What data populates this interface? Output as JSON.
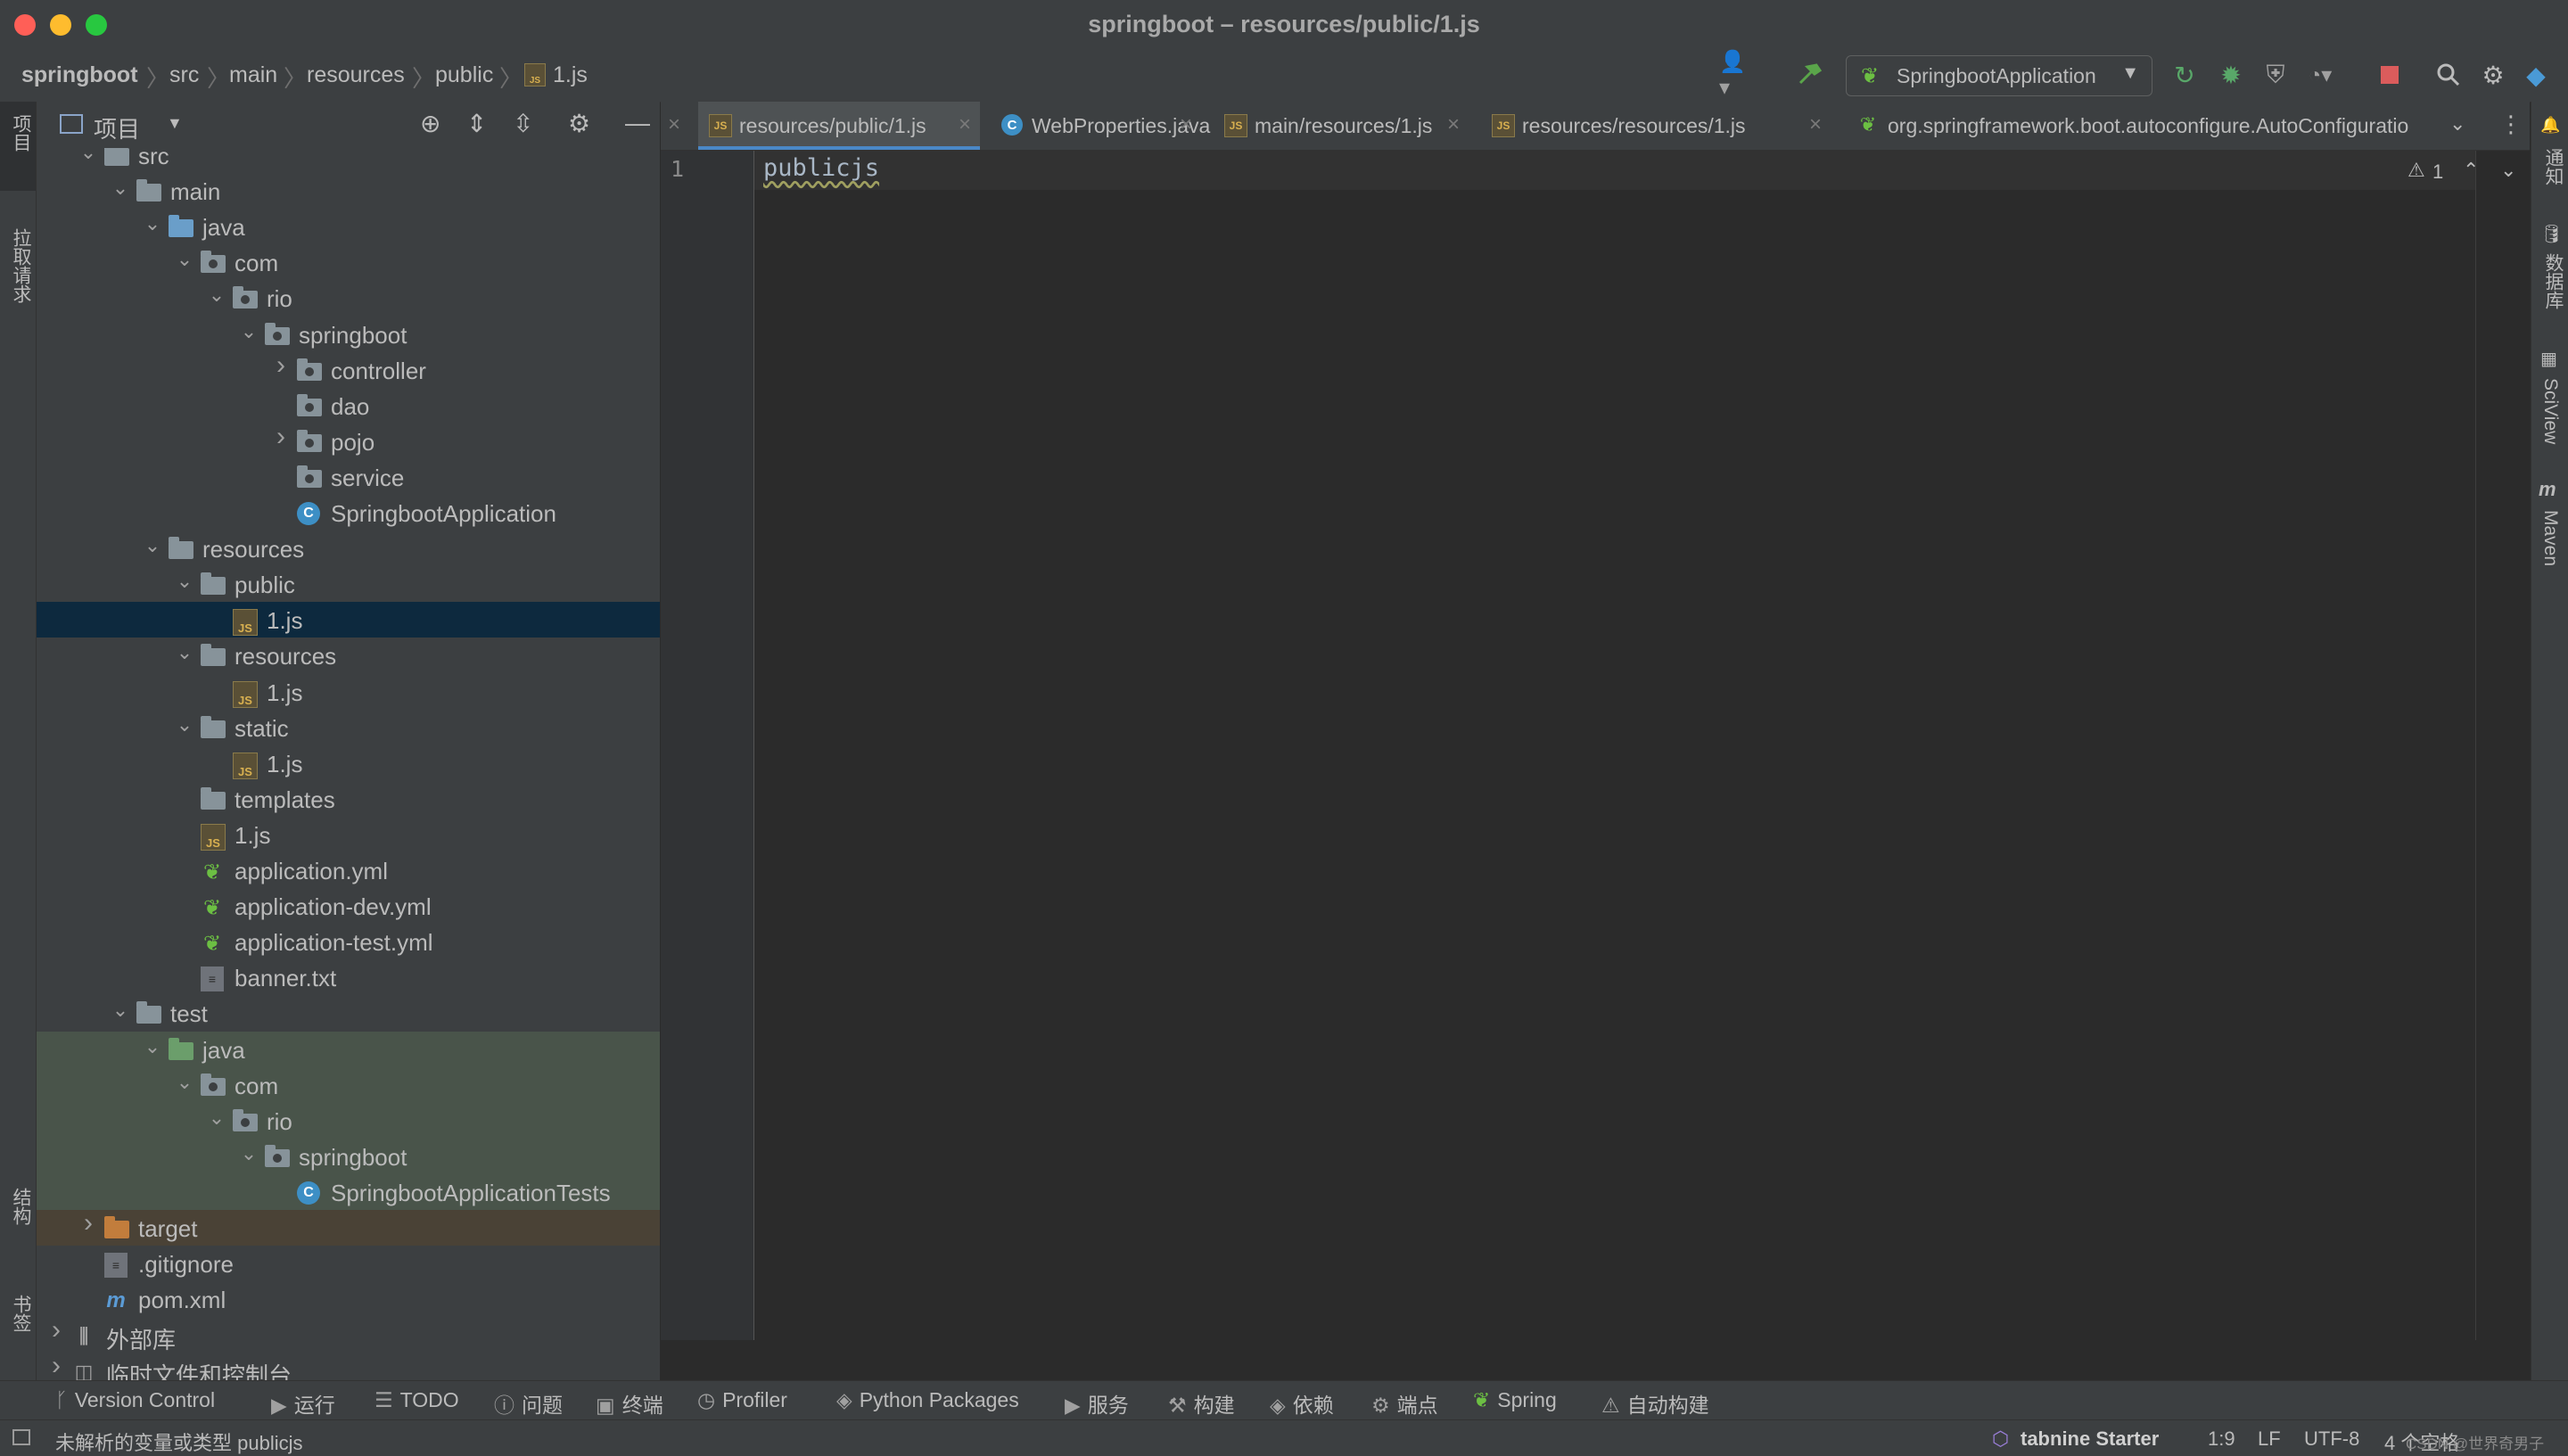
{
  "window": {
    "title": "springboot – resources/public/1.js"
  },
  "breadcrumbs": [
    "springboot",
    "src",
    "main",
    "resources",
    "public",
    "1.js"
  ],
  "run_config": {
    "label": "SpringbootApplication"
  },
  "project_panel": {
    "title": "项目"
  },
  "left_strip": {
    "project": "项目",
    "pull_requests": "拉取请求",
    "structure": "结构",
    "bookmarks": "书签"
  },
  "right_strip": {
    "notifications": "通知",
    "database": "数据库",
    "sciview": "SciView",
    "maven": "Maven"
  },
  "tree": [
    {
      "label": "src",
      "depth": 1,
      "chevron": "open",
      "icon": "folder"
    },
    {
      "label": "main",
      "depth": 2,
      "chevron": "open",
      "icon": "folder"
    },
    {
      "label": "java",
      "depth": 3,
      "chevron": "open",
      "icon": "folder-blue"
    },
    {
      "label": "com",
      "depth": 4,
      "chevron": "open",
      "icon": "package"
    },
    {
      "label": "rio",
      "depth": 5,
      "chevron": "open",
      "icon": "package"
    },
    {
      "label": "springboot",
      "depth": 6,
      "chevron": "open",
      "icon": "package"
    },
    {
      "label": "controller",
      "depth": 7,
      "chevron": "closed",
      "icon": "package"
    },
    {
      "label": "dao",
      "depth": 7,
      "chevron": "none",
      "icon": "package"
    },
    {
      "label": "pojo",
      "depth": 7,
      "chevron": "closed",
      "icon": "package"
    },
    {
      "label": "service",
      "depth": 7,
      "chevron": "none",
      "icon": "package"
    },
    {
      "label": "SpringbootApplication",
      "depth": 7,
      "chevron": "none",
      "icon": "spring-class"
    },
    {
      "label": "resources",
      "depth": 3,
      "chevron": "open",
      "icon": "folder-res"
    },
    {
      "label": "public",
      "depth": 4,
      "chevron": "open",
      "icon": "folder"
    },
    {
      "label": "1.js",
      "depth": 5,
      "chevron": "none",
      "icon": "js",
      "selected": true
    },
    {
      "label": "resources",
      "depth": 4,
      "chevron": "open",
      "icon": "folder"
    },
    {
      "label": "1.js",
      "depth": 5,
      "chevron": "none",
      "icon": "js"
    },
    {
      "label": "static",
      "depth": 4,
      "chevron": "open",
      "icon": "folder"
    },
    {
      "label": "1.js",
      "depth": 5,
      "chevron": "none",
      "icon": "js"
    },
    {
      "label": "templates",
      "depth": 4,
      "chevron": "none",
      "icon": "folder"
    },
    {
      "label": "1.js",
      "depth": 4,
      "chevron": "none",
      "icon": "js"
    },
    {
      "label": "application.yml",
      "depth": 4,
      "chevron": "none",
      "icon": "spring-yml"
    },
    {
      "label": "application-dev.yml",
      "depth": 4,
      "chevron": "none",
      "icon": "spring-yml"
    },
    {
      "label": "application-test.yml",
      "depth": 4,
      "chevron": "none",
      "icon": "spring-yml"
    },
    {
      "label": "banner.txt",
      "depth": 4,
      "chevron": "none",
      "icon": "txt"
    },
    {
      "label": "test",
      "depth": 2,
      "chevron": "open",
      "icon": "folder"
    },
    {
      "label": "java",
      "depth": 3,
      "chevron": "open",
      "icon": "folder-green",
      "test": true
    },
    {
      "label": "com",
      "depth": 4,
      "chevron": "open",
      "icon": "package",
      "test": true
    },
    {
      "label": "rio",
      "depth": 5,
      "chevron": "open",
      "icon": "package",
      "test": true
    },
    {
      "label": "springboot",
      "depth": 6,
      "chevron": "open",
      "icon": "package",
      "test": true
    },
    {
      "label": "SpringbootApplicationTests",
      "depth": 7,
      "chevron": "none",
      "icon": "class",
      "test": true
    },
    {
      "label": "target",
      "depth": 1,
      "chevron": "closed",
      "icon": "folder-orange",
      "excluded": true
    },
    {
      "label": ".gitignore",
      "depth": 1,
      "chevron": "none",
      "icon": "txt"
    },
    {
      "label": "pom.xml",
      "depth": 1,
      "chevron": "none",
      "icon": "maven"
    },
    {
      "label": "外部库",
      "depth": 0,
      "chevron": "closed",
      "icon": "libs"
    },
    {
      "label": "临时文件和控制台",
      "depth": 0,
      "chevron": "closed",
      "icon": "scratch"
    }
  ],
  "tabs": [
    {
      "label": "resources/public/1.js",
      "icon": "js",
      "active": true
    },
    {
      "label": "WebProperties.java",
      "icon": "class"
    },
    {
      "label": "main/resources/1.js",
      "icon": "js"
    },
    {
      "label": "resources/resources/1.js",
      "icon": "js"
    },
    {
      "label": "org.springframework.boot.autoconfigure.AutoConfiguratio",
      "icon": "spring"
    }
  ],
  "editor": {
    "line_number": "1",
    "code": "publicjs",
    "warning_count": "1"
  },
  "bottom_tools": [
    "Version Control",
    "运行",
    "TODO",
    "问题",
    "终端",
    "Profiler",
    "Python Packages",
    "服务",
    "构建",
    "依赖",
    "端点",
    "Spring",
    "自动构建"
  ],
  "status": {
    "message": "未解析的变量或类型 publicjs",
    "tabnine": "tabnine Starter",
    "position": "1:9",
    "line_sep": "LF",
    "encoding": "UTF-8",
    "indent": "4 个空格",
    "watermark": "CSDN @世界奇男子"
  },
  "colors": {
    "selection": "#0d293e",
    "test_bg": "#49544a",
    "excluded_bg": "#4a4236",
    "accent": "#4a88c7"
  }
}
